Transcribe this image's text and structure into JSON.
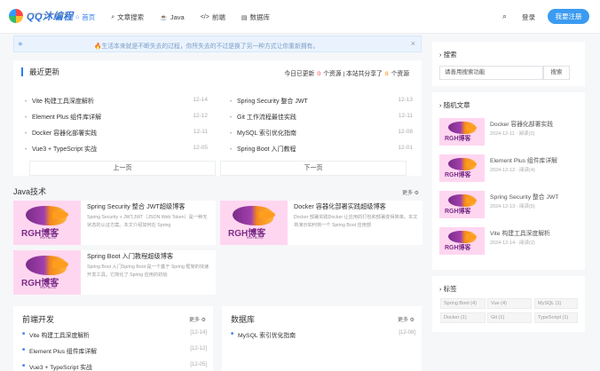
{
  "header": {
    "logo_text": "QQ沐编程",
    "logo_sub": "CODING AND LEARNING",
    "nav": [
      {
        "icon": "home-icon",
        "glyph": "⌂",
        "label": "首页",
        "active": true
      },
      {
        "icon": "search-icon",
        "glyph": "⌕",
        "label": "文章搜索",
        "active": false
      },
      {
        "icon": "coffee-icon",
        "glyph": "☕",
        "label": "Java",
        "active": false
      },
      {
        "icon": "code-icon",
        "glyph": "</>",
        "label": "前端",
        "active": false
      },
      {
        "icon": "database-icon",
        "glyph": "▤",
        "label": "数据库",
        "active": false
      }
    ],
    "search_glyph": "⌕",
    "login": "登录",
    "register": "我要注册"
  },
  "notice": {
    "text": "🔥生活本来就是不断失去的过程，你所失去的不过是换了另一种方式让你重新拥有。",
    "close": "×",
    "spinner": "✳"
  },
  "recent": {
    "title": "最近更新",
    "stats_prefix": "今日已更新",
    "today_count": "0",
    "stats_mid": "个资源 | 本站共分享了",
    "total_count": "8",
    "stats_suffix": "个资源",
    "left": [
      {
        "title": "Vite 构建工具深度解析",
        "date": "12-14"
      },
      {
        "title": "Element Plus 组件库详解",
        "date": "12-12"
      },
      {
        "title": "Docker 容器化部署实践",
        "date": "12-11"
      },
      {
        "title": "Vue3 + TypeScript 实战",
        "date": "12-05"
      }
    ],
    "right": [
      {
        "title": "Spring Security 整合 JWT",
        "date": "12-13"
      },
      {
        "title": "Git 工作流程最佳实践",
        "date": "12-11"
      },
      {
        "title": "MySQL 索引优化指南",
        "date": "12-08"
      },
      {
        "title": "Spring Boot 入门教程",
        "date": "12-01"
      }
    ],
    "prev": "上一页",
    "next": "下一页"
  },
  "java": {
    "title": "Java技术",
    "more": "更多 ⚙",
    "cards": [
      {
        "title": "Spring Security 整合 JWT超级博客",
        "excerpt": "Spring Security + JWT,JWT（JSON Web Token）是一种无状态的认证方案。本文介绍如何在 Spring"
      },
      {
        "title": "Docker 容器化部署实践超级博客",
        "excerpt": "Docker 部署实践Docker 让应用的打包和部署变得简单。本文将演示如何将一个 Spring Boot 应用部"
      },
      {
        "title": "Spring Boot 入门教程超级博客",
        "excerpt": "Spring Boot 入门Spring Boot 是一个基于 Spring 框架的快速开发工具。它简化了 Spring 应用的初始"
      }
    ]
  },
  "thumb": {
    "brand": "RGH博客",
    "brand_sub": "RGH BLOG"
  },
  "frontend": {
    "title": "前端开发",
    "more": "更多 ⚙",
    "items": [
      {
        "title": "Vite 构建工具深度解析",
        "date": "[12-14]"
      },
      {
        "title": "Element Plus 组件库详解",
        "date": "[12-12]"
      },
      {
        "title": "Vue3 + TypeScript 实战",
        "date": "[12-05]"
      }
    ]
  },
  "database": {
    "title": "数据库",
    "more": "更多 ⚙",
    "items": [
      {
        "title": "MySQL 索引优化指南",
        "date": "[12-08]"
      }
    ]
  },
  "sidebar": {
    "search_title": "搜索",
    "search_placeholder": "请善用搜索功能",
    "search_button": "搜索",
    "random_title": "随机文章",
    "random": [
      {
        "title": "Docker 容器化部署实践",
        "meta": "2024-12-11 · 阅读(2)"
      },
      {
        "title": "Element Plus 组件库详解",
        "meta": "2024-12-12 · 阅读(4)"
      },
      {
        "title": "Spring Security 整合 JWT",
        "meta": "2024-12-13 · 阅读(5)"
      },
      {
        "title": "Vite 构建工具深度解析",
        "meta": "2024-12-14 · 阅读(2)"
      }
    ],
    "tags_title": "标签",
    "tags": [
      "Spring Boot (4)",
      "Vue (4)",
      "MySQL (1)",
      "Docker (1)",
      "Git (1)",
      "TypeScript (1)"
    ]
  }
}
